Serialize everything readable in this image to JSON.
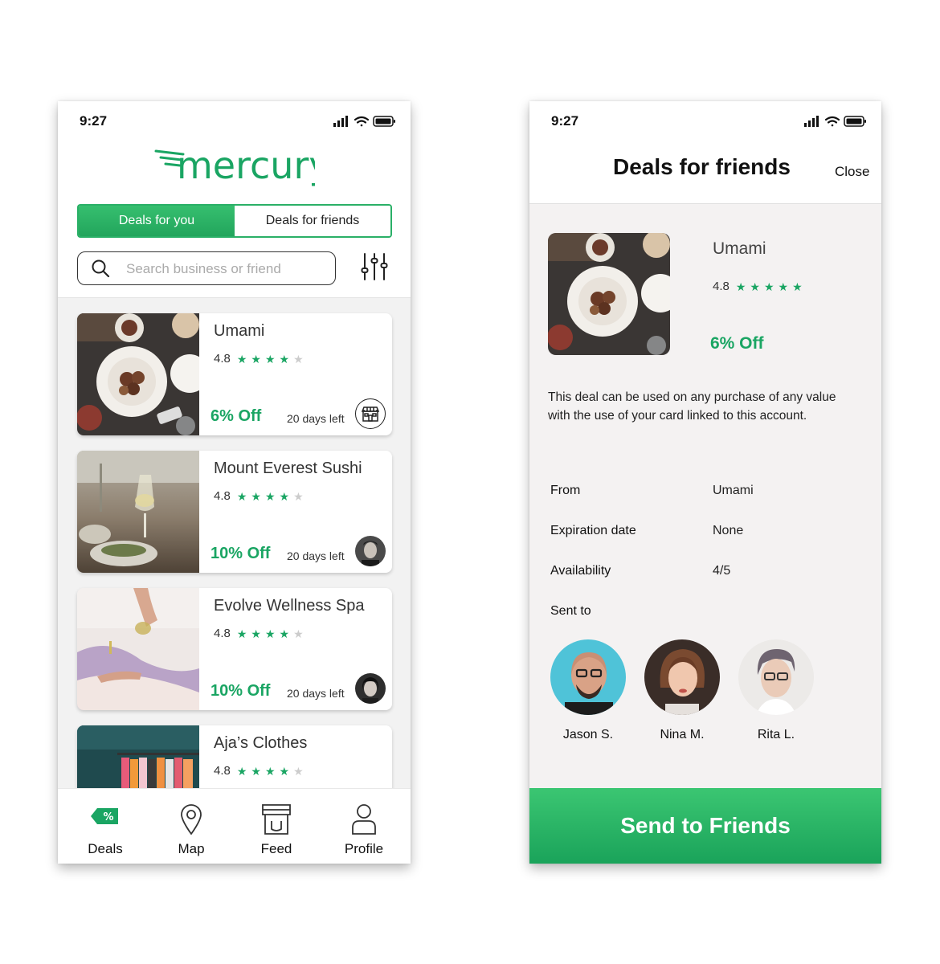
{
  "status_bar": {
    "time": "9:27"
  },
  "left": {
    "logo_text": "mercury",
    "segmented": {
      "active": "Deals for you",
      "inactive": "Deals for friends"
    },
    "search": {
      "placeholder": "Search business or friend"
    },
    "deals": [
      {
        "name": "Umami",
        "rating": "4.8",
        "stars": 4,
        "discount": "6% Off",
        "days_left": "20 days left",
        "badge": "store-icon"
      },
      {
        "name": "Mount Everest Sushi",
        "rating": "4.8",
        "stars": 4,
        "discount": "10% Off",
        "days_left": "20 days left",
        "badge": "friend-avatar"
      },
      {
        "name": "Evolve Wellness Spa",
        "rating": "4.8",
        "stars": 4,
        "discount": "10% Off",
        "days_left": "20 days left",
        "badge": "friend-avatar"
      },
      {
        "name": "Aja’s Clothes",
        "rating": "4.8",
        "stars": 4
      }
    ],
    "tabs": [
      {
        "label": "Deals",
        "icon": "discount-tag-icon",
        "active": true
      },
      {
        "label": "Map",
        "icon": "map-pin-icon"
      },
      {
        "label": "Feed",
        "icon": "store-icon"
      },
      {
        "label": "Profile",
        "icon": "person-icon"
      }
    ]
  },
  "right": {
    "title": "Deals for friends",
    "close_label": "Close",
    "deal": {
      "name": "Umami",
      "rating": "4.8",
      "stars": 5,
      "discount": "6% Off"
    },
    "description": "This deal can be used on any purchase of any value with the use of your card linked to this account.",
    "details": [
      {
        "label": "From",
        "value": "Umami"
      },
      {
        "label": "Expiration date",
        "value": "None"
      },
      {
        "label": "Availability",
        "value": "4/5"
      }
    ],
    "sent_to_label": "Sent to",
    "friends": [
      {
        "name": "Jason S."
      },
      {
        "name": "Nina M."
      },
      {
        "name": "Rita L."
      }
    ],
    "button_label": "Send to Friends"
  },
  "colors": {
    "brand_green": "#1aa563",
    "button_green": "#2fb868",
    "panel_bg": "#f4f2f2"
  }
}
